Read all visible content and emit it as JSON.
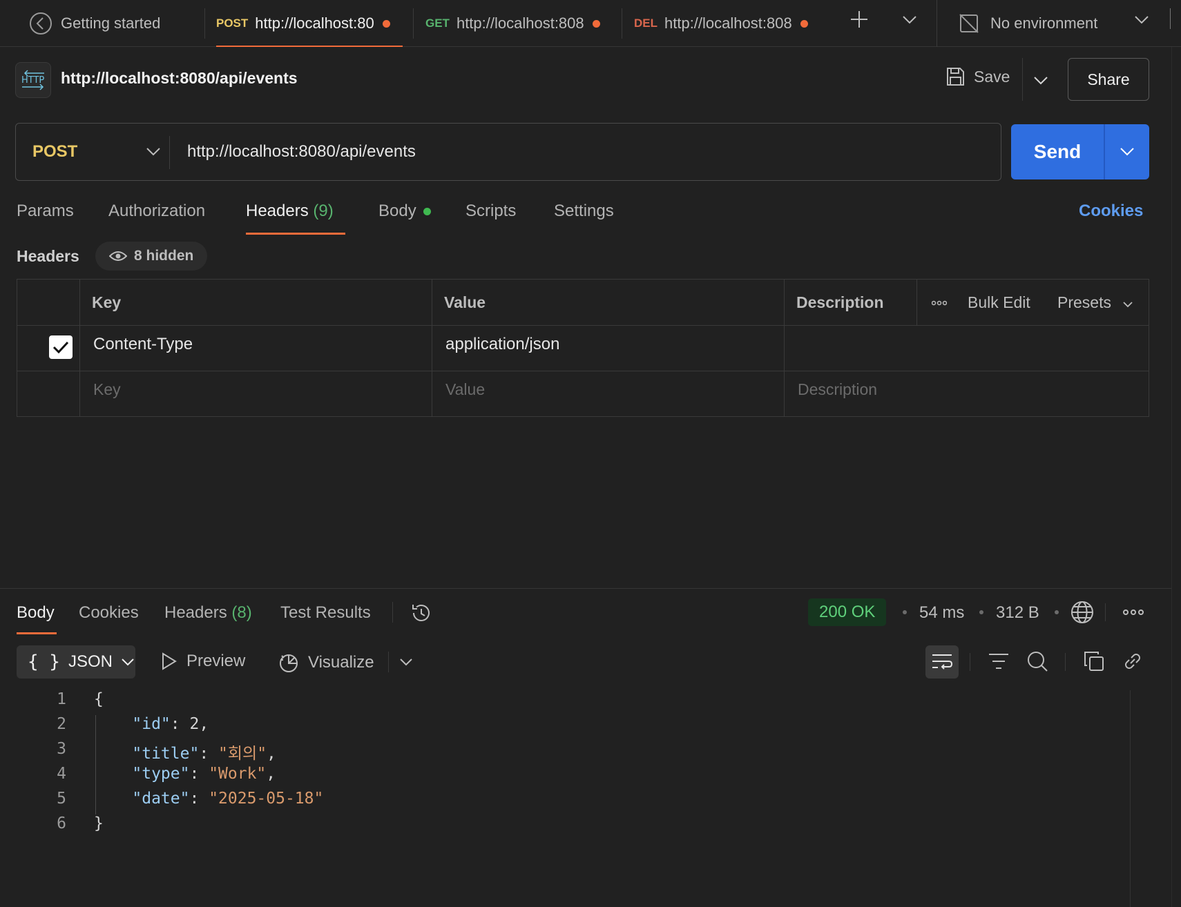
{
  "tabs": {
    "getting_started": "Getting started",
    "items": [
      {
        "method": "POST",
        "url": "http://localhost:80",
        "method_color": "#e8c765"
      },
      {
        "method": "GET",
        "url": "http://localhost:808",
        "method_color": "#58b36e"
      },
      {
        "method": "DEL",
        "url": "http://localhost:808",
        "method_color": "#d9664d"
      }
    ],
    "environment": "No environment"
  },
  "request": {
    "title": "http://localhost:8080/api/events",
    "save_label": "Save",
    "share_label": "Share",
    "method": "POST",
    "url": "http://localhost:8080/api/events",
    "send_label": "Send"
  },
  "request_tabs": {
    "params": "Params",
    "authorization": "Authorization",
    "headers": "Headers",
    "headers_count": "(9)",
    "body": "Body",
    "scripts": "Scripts",
    "settings": "Settings",
    "cookies": "Cookies"
  },
  "headers_section": {
    "label": "Headers",
    "hidden": "8 hidden",
    "columns": {
      "key": "Key",
      "value": "Value",
      "description": "Description"
    },
    "bulk_edit": "Bulk Edit",
    "presets": "Presets",
    "rows": [
      {
        "checked": true,
        "key": "Content-Type",
        "value": "application/json",
        "description": ""
      }
    ],
    "placeholders": {
      "key": "Key",
      "value": "Value",
      "description": "Description"
    }
  },
  "response": {
    "tabs": {
      "body": "Body",
      "cookies": "Cookies",
      "headers": "Headers",
      "headers_count": "(8)",
      "test_results": "Test Results"
    },
    "status": "200 OK",
    "time": "54 ms",
    "size": "312 B",
    "format": "JSON",
    "preview": "Preview",
    "visualize": "Visualize",
    "code_lines": [
      {
        "n": "1",
        "parts": [
          {
            "t": "{",
            "c": "n"
          }
        ]
      },
      {
        "n": "2",
        "parts": [
          {
            "t": "    ",
            "c": "n"
          },
          {
            "t": "\"id\"",
            "c": "k"
          },
          {
            "t": ": 2,",
            "c": "n"
          }
        ]
      },
      {
        "n": "3",
        "parts": [
          {
            "t": "    ",
            "c": "n"
          },
          {
            "t": "\"title\"",
            "c": "k"
          },
          {
            "t": ": ",
            "c": "n"
          },
          {
            "t": "\"회의\"",
            "c": "s"
          },
          {
            "t": ",",
            "c": "n"
          }
        ]
      },
      {
        "n": "4",
        "parts": [
          {
            "t": "    ",
            "c": "n"
          },
          {
            "t": "\"type\"",
            "c": "k"
          },
          {
            "t": ": ",
            "c": "n"
          },
          {
            "t": "\"Work\"",
            "c": "s"
          },
          {
            "t": ",",
            "c": "n"
          }
        ]
      },
      {
        "n": "5",
        "parts": [
          {
            "t": "    ",
            "c": "n"
          },
          {
            "t": "\"date\"",
            "c": "k"
          },
          {
            "t": ": ",
            "c": "n"
          },
          {
            "t": "\"2025-05-18\"",
            "c": "s"
          }
        ]
      },
      {
        "n": "6",
        "parts": [
          {
            "t": "}",
            "c": "n"
          }
        ]
      }
    ]
  },
  "colors": {
    "accent": "#f26b3a",
    "send": "#2f6ee0",
    "cookies_link": "#5e9cf0",
    "status_ok": "#5fd07b"
  }
}
